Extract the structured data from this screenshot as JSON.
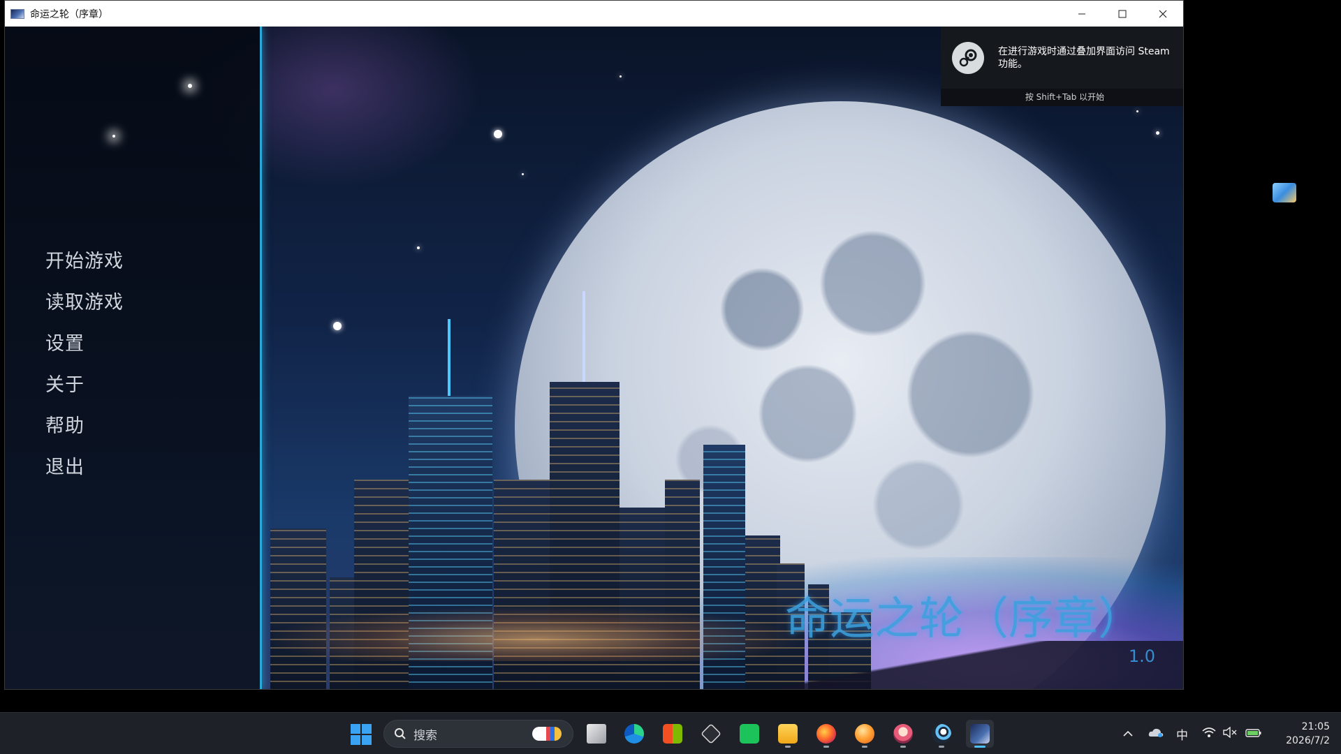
{
  "window": {
    "title": "命运之轮（序章）",
    "controls": [
      "minimize-icon",
      "maximize-icon",
      "close-icon"
    ]
  },
  "menu": {
    "items": [
      {
        "label": "开始游戏"
      },
      {
        "label": "读取游戏"
      },
      {
        "label": "设置"
      },
      {
        "label": "关于"
      },
      {
        "label": "帮助"
      },
      {
        "label": "退出"
      }
    ]
  },
  "game": {
    "title": "命运之轮（序章）",
    "version": "1.0"
  },
  "steam_overlay": {
    "message": "在进行游戏时通过叠加界面访问 Steam 功能。",
    "hint": "按 Shift+Tab 以开始"
  },
  "taskbar": {
    "search_placeholder": "搜索",
    "apps": [
      {
        "icon": "task-view-icon"
      },
      {
        "icon": "edge-icon"
      },
      {
        "icon": "store-icon"
      },
      {
        "icon": "unity-icon"
      },
      {
        "icon": "wechat-icon"
      },
      {
        "icon": "file-explorer-icon"
      },
      {
        "icon": "firefox-icon"
      },
      {
        "icon": "orange-app-icon"
      },
      {
        "icon": "anime-girl-app-icon"
      },
      {
        "icon": "steam-icon"
      },
      {
        "icon": "game-window-icon"
      }
    ],
    "tray": {
      "ime": "中"
    },
    "clock": {
      "time": "21:05",
      "date": "2026/7/2"
    }
  },
  "colors": {
    "accent_line": "#2aa8d8",
    "game_title": "#3ca0dc",
    "taskbar_bg": "#1e2228",
    "active_indicator": "#4cc2ff"
  }
}
